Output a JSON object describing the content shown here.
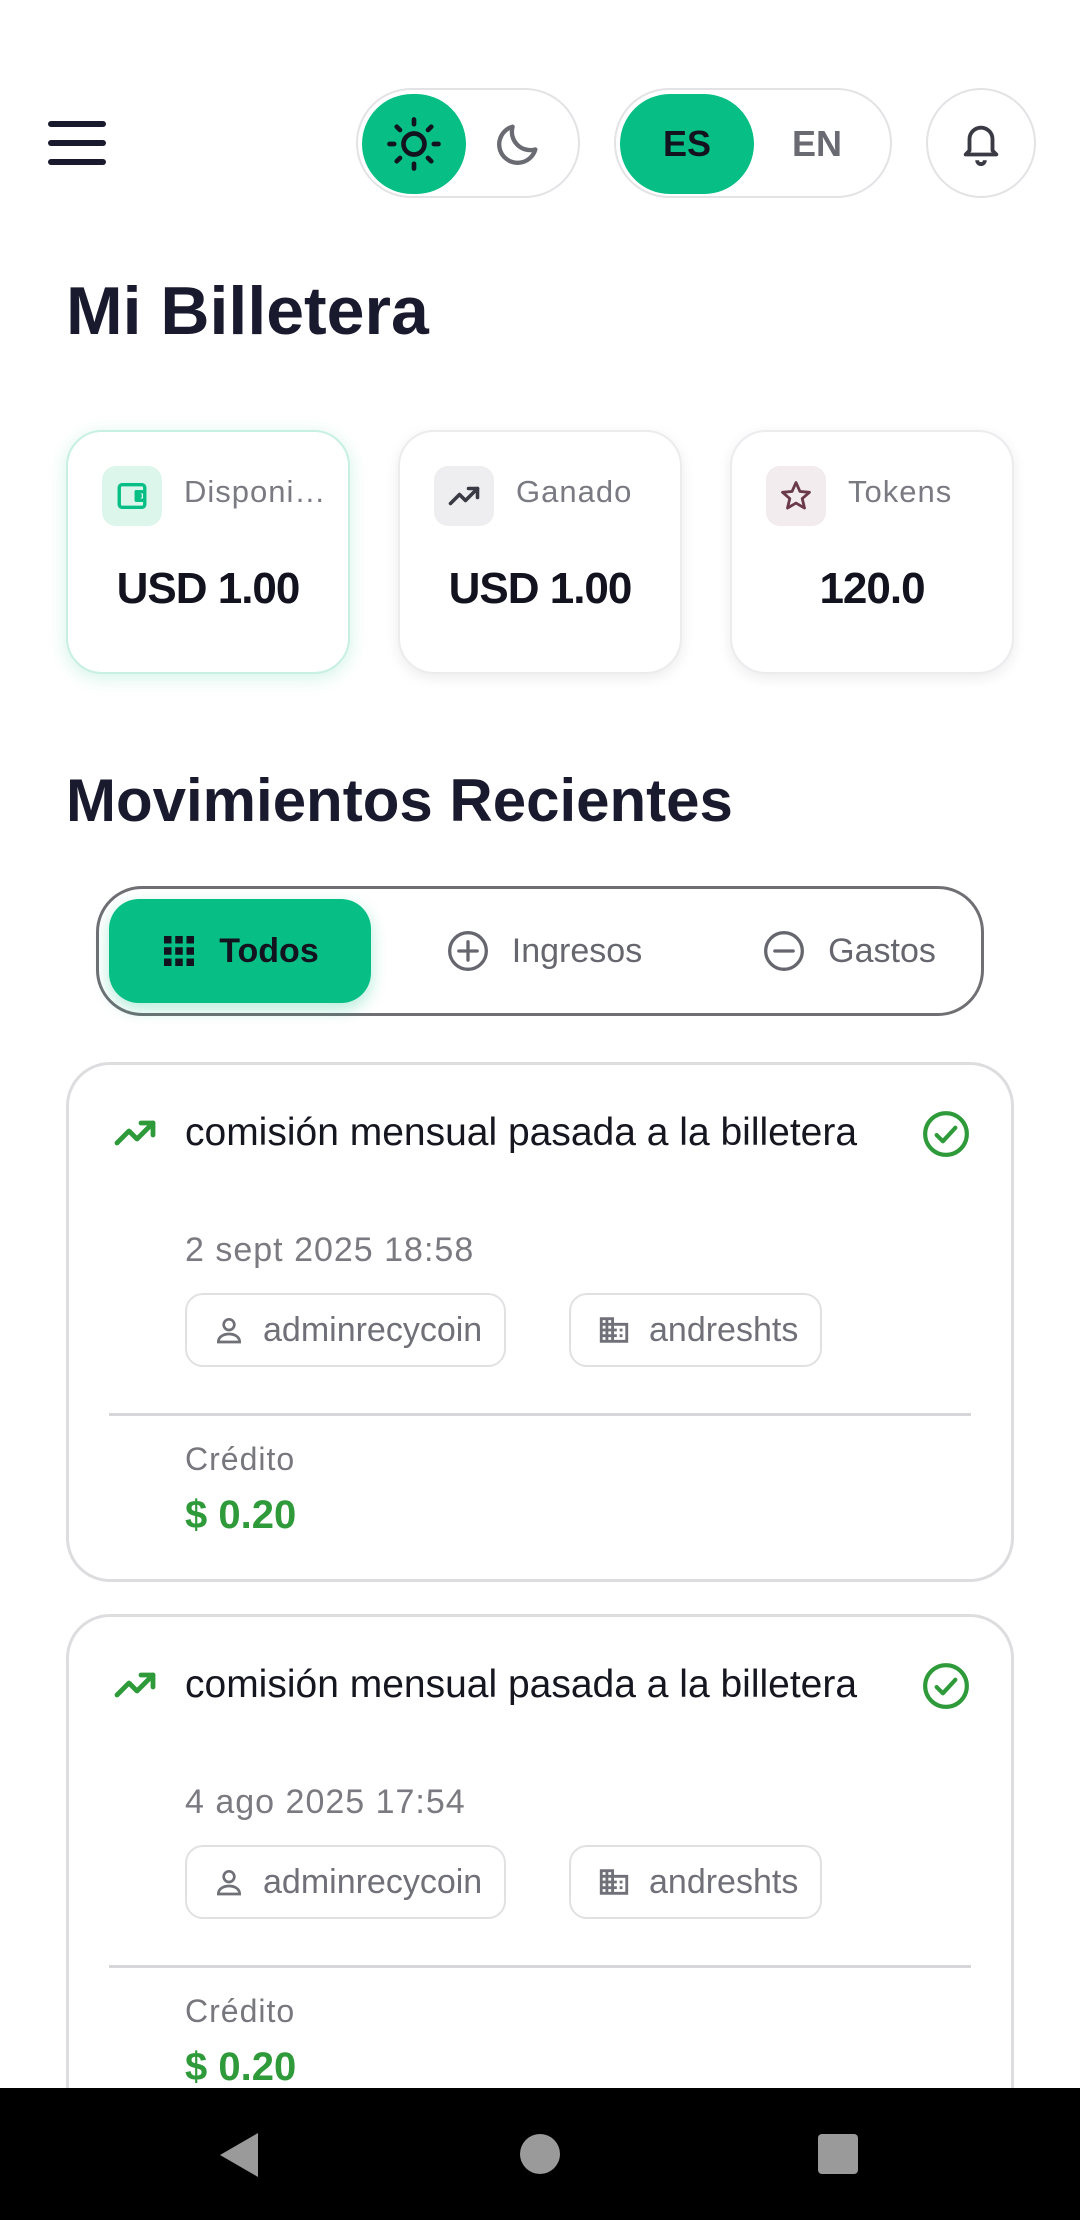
{
  "header": {
    "theme_icons": {
      "light": "sun-icon",
      "dark": "moon-icon"
    },
    "language": {
      "active": "ES",
      "inactive": "EN"
    },
    "notification_icon": "bell-icon"
  },
  "page_title": "Mi Billetera",
  "summary": [
    {
      "label": "Disponible",
      "value": "USD 1.00",
      "icon": "wallet-icon"
    },
    {
      "label": "Ganado",
      "value": "USD 1.00",
      "icon": "trending-up-icon"
    },
    {
      "label": "Tokens",
      "value": "120.0",
      "icon": "star-icon"
    }
  ],
  "section_title": "Movimientos Recientes",
  "filters": {
    "all": "Todos",
    "income": "Ingresos",
    "expenses": "Gastos"
  },
  "transactions": [
    {
      "title": "comisión mensual pasada a la billetera",
      "date": "2 sept 2025 18:58",
      "user": "adminrecycoin",
      "org": "andreshts",
      "kind_label": "Crédito",
      "amount": "$ 0.20"
    },
    {
      "title": "comisión mensual pasada a la billetera",
      "date": "4 ago 2025 17:54",
      "user": "adminrecycoin",
      "org": "andreshts",
      "kind_label": "Crédito",
      "amount": "$ 0.20"
    }
  ],
  "colors": {
    "accent": "#07bf84",
    "credit": "#2e9a3a",
    "text": "#1a1a2e"
  }
}
